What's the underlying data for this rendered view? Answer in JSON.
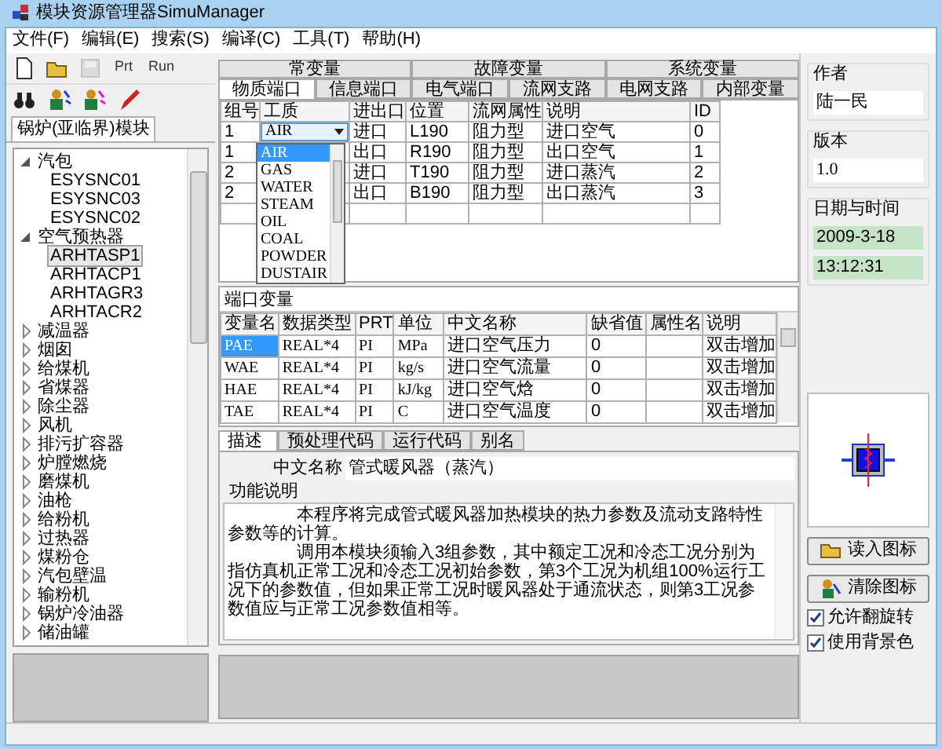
{
  "window": {
    "title": "模块资源管理器SimuManager"
  },
  "menu": [
    "文件(F)",
    "编辑(E)",
    "搜索(S)",
    "编译(C)",
    "工具(T)",
    "帮助(H)"
  ],
  "toolbar": [
    {
      "kind": "new",
      "disabled": false
    },
    {
      "kind": "open",
      "disabled": false
    },
    {
      "kind": "save",
      "disabled": true
    },
    {
      "kind": "text",
      "label": "Prt",
      "disabled": false
    },
    {
      "kind": "text",
      "label": "Run",
      "disabled": false
    }
  ],
  "toolbar2": [
    {
      "kind": "find"
    },
    {
      "kind": "figure-blue"
    },
    {
      "kind": "figure-pink"
    },
    {
      "kind": "pen"
    }
  ],
  "tree": {
    "tab": "锅炉(亚临界)模块",
    "items": [
      {
        "label": "汽包",
        "expanded": true,
        "selected": false,
        "children": [
          {
            "label": "ESYSNC01",
            "selected": false
          },
          {
            "label": "ESYSNC03",
            "selected": false
          },
          {
            "label": "ESYSNC02",
            "selected": false
          }
        ]
      },
      {
        "label": "空气预热器",
        "expanded": true,
        "selected": false,
        "children": [
          {
            "label": "ARHTASP1",
            "selected": true
          },
          {
            "label": "ARHTACP1",
            "selected": false
          },
          {
            "label": "ARHTAGR3",
            "selected": false
          },
          {
            "label": "ARHTACR2",
            "selected": false
          }
        ]
      },
      {
        "label": "减温器",
        "expanded": false,
        "selected": false
      },
      {
        "label": "烟囱",
        "expanded": false,
        "selected": false
      },
      {
        "label": "给煤机",
        "expanded": false,
        "selected": false
      },
      {
        "label": "省煤器",
        "expanded": false,
        "selected": false
      },
      {
        "label": "除尘器",
        "expanded": false,
        "selected": false
      },
      {
        "label": "风机",
        "expanded": false,
        "selected": false
      },
      {
        "label": "排污扩容器",
        "expanded": false,
        "selected": false
      },
      {
        "label": "炉膛燃烧",
        "expanded": false,
        "selected": false
      },
      {
        "label": "磨煤机",
        "expanded": false,
        "selected": false
      },
      {
        "label": "油枪",
        "expanded": false,
        "selected": false
      },
      {
        "label": "给粉机",
        "expanded": false,
        "selected": false
      },
      {
        "label": "过热器",
        "expanded": false,
        "selected": false
      },
      {
        "label": "煤粉仓",
        "expanded": false,
        "selected": false
      },
      {
        "label": "汽包壁温",
        "expanded": false,
        "selected": false
      },
      {
        "label": "输粉机",
        "expanded": false,
        "selected": false
      },
      {
        "label": "锅炉冷油器",
        "expanded": false,
        "selected": false
      },
      {
        "label": "储油罐",
        "expanded": false,
        "selected": false
      }
    ]
  },
  "tabs_back": [
    {
      "label": "常变量",
      "selected": false
    },
    {
      "label": "故障变量",
      "selected": false
    },
    {
      "label": "系统变量",
      "selected": false
    }
  ],
  "tabs_front": [
    {
      "label": "物质端口",
      "selected": true
    },
    {
      "label": "信息端口",
      "selected": false
    },
    {
      "label": "电气端口",
      "selected": false
    },
    {
      "label": "流网支路",
      "selected": false
    },
    {
      "label": "电网支路",
      "selected": false
    },
    {
      "label": "内部变量",
      "selected": false
    }
  ],
  "port_table": {
    "columns": [
      "组号",
      "工质",
      "进出口",
      "位置",
      "流网属性",
      "说明",
      "ID"
    ],
    "rows": [
      {
        "group": "1",
        "medium": "AIR",
        "io": "进口",
        "position": "L190",
        "attribute": "阻力型",
        "description": "进口空气",
        "id": "0"
      },
      {
        "group": "1",
        "io": "出口",
        "position": "R190",
        "attribute": "阻力型",
        "description": "出口空气",
        "id": "1"
      },
      {
        "group": "2",
        "io": "进口",
        "position": "T190",
        "attribute": "阻力型",
        "description": "进口蒸汽",
        "id": "2"
      },
      {
        "group": "2",
        "io": "出口",
        "position": "B190",
        "attribute": "阻力型",
        "description": "出口蒸汽",
        "id": "3"
      }
    ],
    "dropdown": [
      {
        "label": "AIR",
        "selected": true
      },
      {
        "label": "GAS",
        "selected": false
      },
      {
        "label": "WATER",
        "selected": false
      },
      {
        "label": "STEAM",
        "selected": false
      },
      {
        "label": "OIL",
        "selected": false
      },
      {
        "label": "COAL",
        "selected": false
      },
      {
        "label": "POWDER",
        "selected": false
      },
      {
        "label": "DUSTAIR",
        "selected": false
      }
    ]
  },
  "variables": {
    "title": "端口变量",
    "columns": [
      "变量名",
      "数据类型",
      "PRT",
      "单位",
      "中文名称",
      "缺省值",
      "属性名",
      "说明"
    ],
    "rows": [
      {
        "selected": true,
        "cells": [
          "PAE",
          "REAL*4",
          "PI",
          "MPa",
          "进口空气压力",
          "0",
          "",
          "双击增加"
        ]
      },
      {
        "selected": false,
        "cells": [
          "WAE",
          "REAL*4",
          "PI",
          "kg/s",
          "进口空气流量",
          "0",
          "",
          "双击增加"
        ]
      },
      {
        "selected": false,
        "cells": [
          "HAE",
          "REAL*4",
          "PI",
          "kJ/kg",
          "进口空气焓",
          "0",
          "",
          "双击增加"
        ]
      },
      {
        "selected": false,
        "cells": [
          "TAE",
          "REAL*4",
          "PI",
          "C",
          "进口空气温度",
          "0",
          "",
          "双击增加"
        ]
      }
    ]
  },
  "desc_tabs": [
    {
      "label": "描述",
      "selected": true
    },
    {
      "label": "预处理代码",
      "selected": false
    },
    {
      "label": "运行代码",
      "selected": false
    },
    {
      "label": "别名",
      "selected": false
    }
  ],
  "description": {
    "name_label": "中文名称",
    "name": "管式暖风器（蒸汽）",
    "function_label": "功能说明",
    "paragraphs": [
      "本程序将完成管式暖风器加热模块的热力参数及流动支路特性参数等的计算。",
      "调用本模块须输入3组参数，其中额定工况和冷态工况分别为指仿真机正常工况和冷态工况初始参数，第3个工况为机组100%运行工况下的参数值，但如果正常工况时暖风器处于通流状态，则第3工况参数值应与正常工况参数值相等。"
    ]
  },
  "info": {
    "author_label": "作者",
    "author": "陆一民",
    "version_label": "版本",
    "version": "1.0",
    "datetime_label": "日期与时间",
    "date": "2009-3-18",
    "time": "13:12:31"
  },
  "icon_buttons": [
    {
      "kind": "load",
      "label": "读入图标"
    },
    {
      "kind": "clear",
      "label": "清除图标"
    }
  ],
  "options": [
    {
      "label": "允许翻旋转",
      "checked": true
    },
    {
      "label": "使用背景色",
      "checked": true
    }
  ]
}
